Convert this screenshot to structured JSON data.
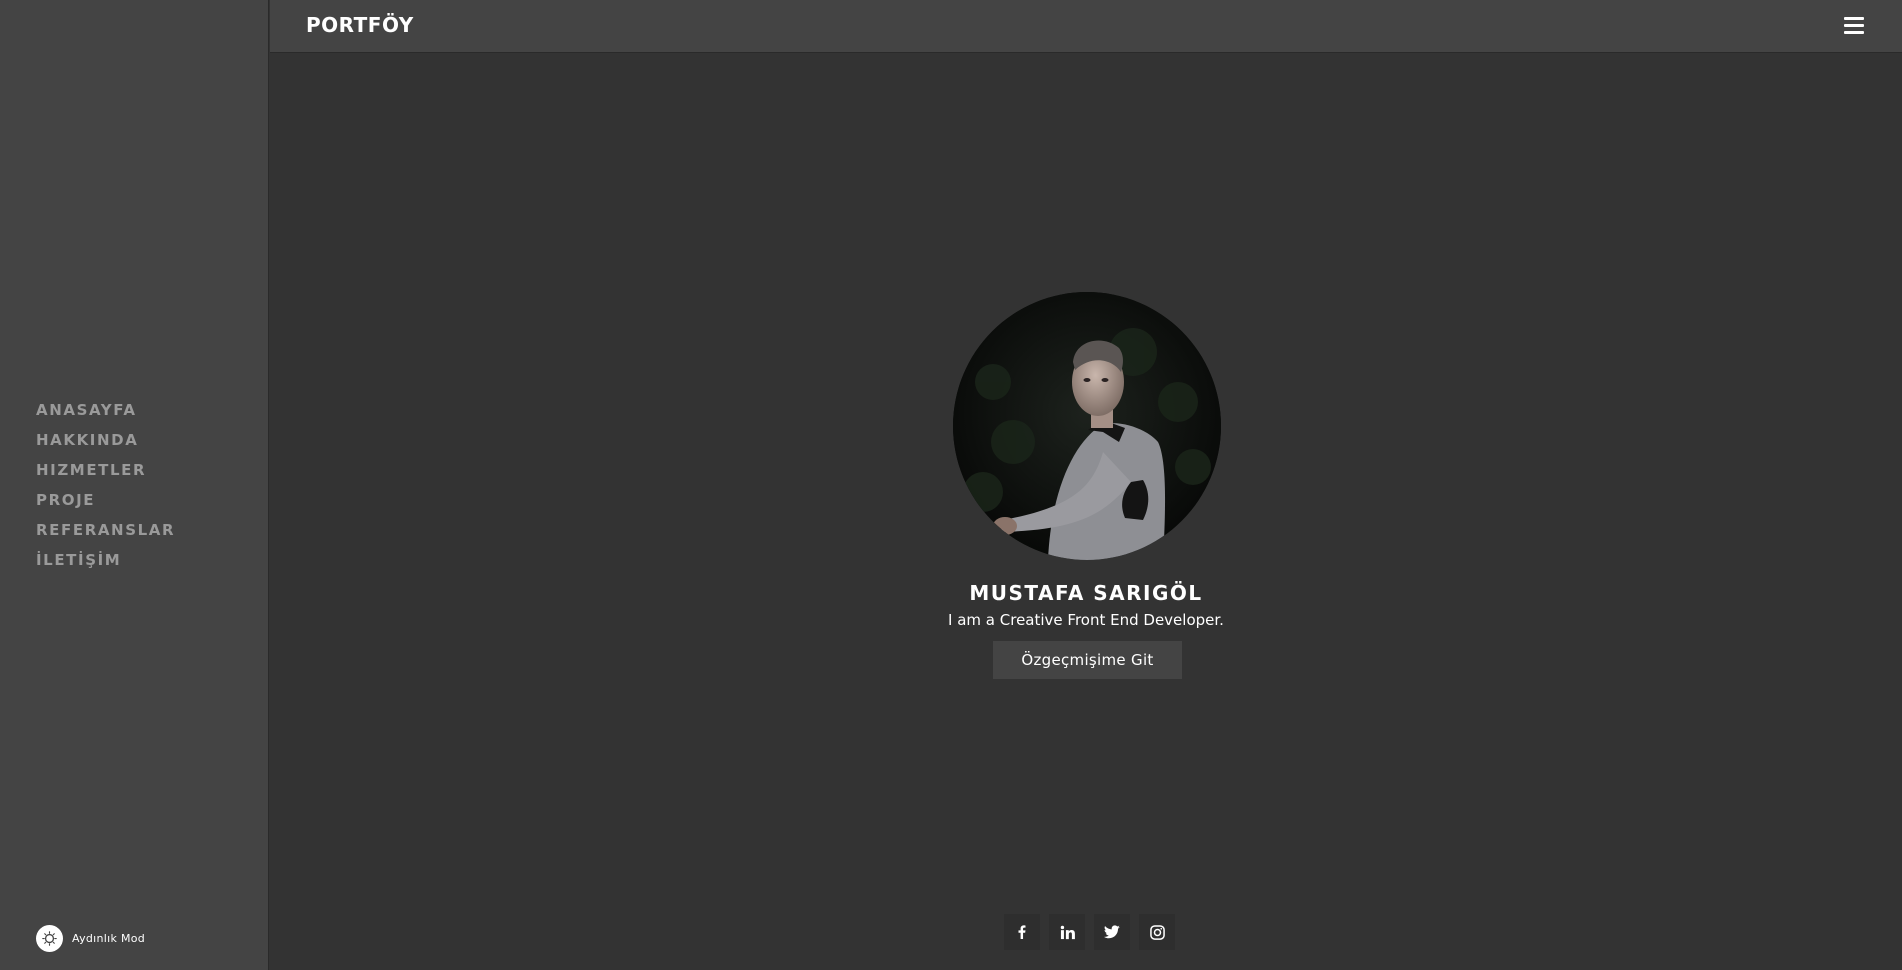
{
  "header": {
    "brand": "PORTFÖY",
    "menu_icon": "hamburger-menu-icon"
  },
  "sidebar": {
    "items": [
      {
        "label": "ANASAYFA"
      },
      {
        "label": "HAKKINDA"
      },
      {
        "label": "HIZMETLER"
      },
      {
        "label": "PROJE"
      },
      {
        "label": "REFERANSLAR"
      },
      {
        "label": "İLETİŞİM"
      }
    ],
    "mode_toggle": {
      "label": "Aydınlık Mod",
      "icon": "sun-icon"
    }
  },
  "hero": {
    "name": "MUSTAFA SARIGÖL",
    "tagline": "I am a Creative Front End Developer.",
    "cv_button": "Özgeçmişime Git",
    "avatar_icon": "profile-photo"
  },
  "socials": [
    {
      "icon": "facebook-icon"
    },
    {
      "icon": "linkedin-icon"
    },
    {
      "icon": "twitter-icon"
    },
    {
      "icon": "instagram-icon"
    }
  ],
  "colors": {
    "background": "#333333",
    "panel": "#444444",
    "nav_text": "#9a9a9a",
    "text": "#ffffff"
  }
}
